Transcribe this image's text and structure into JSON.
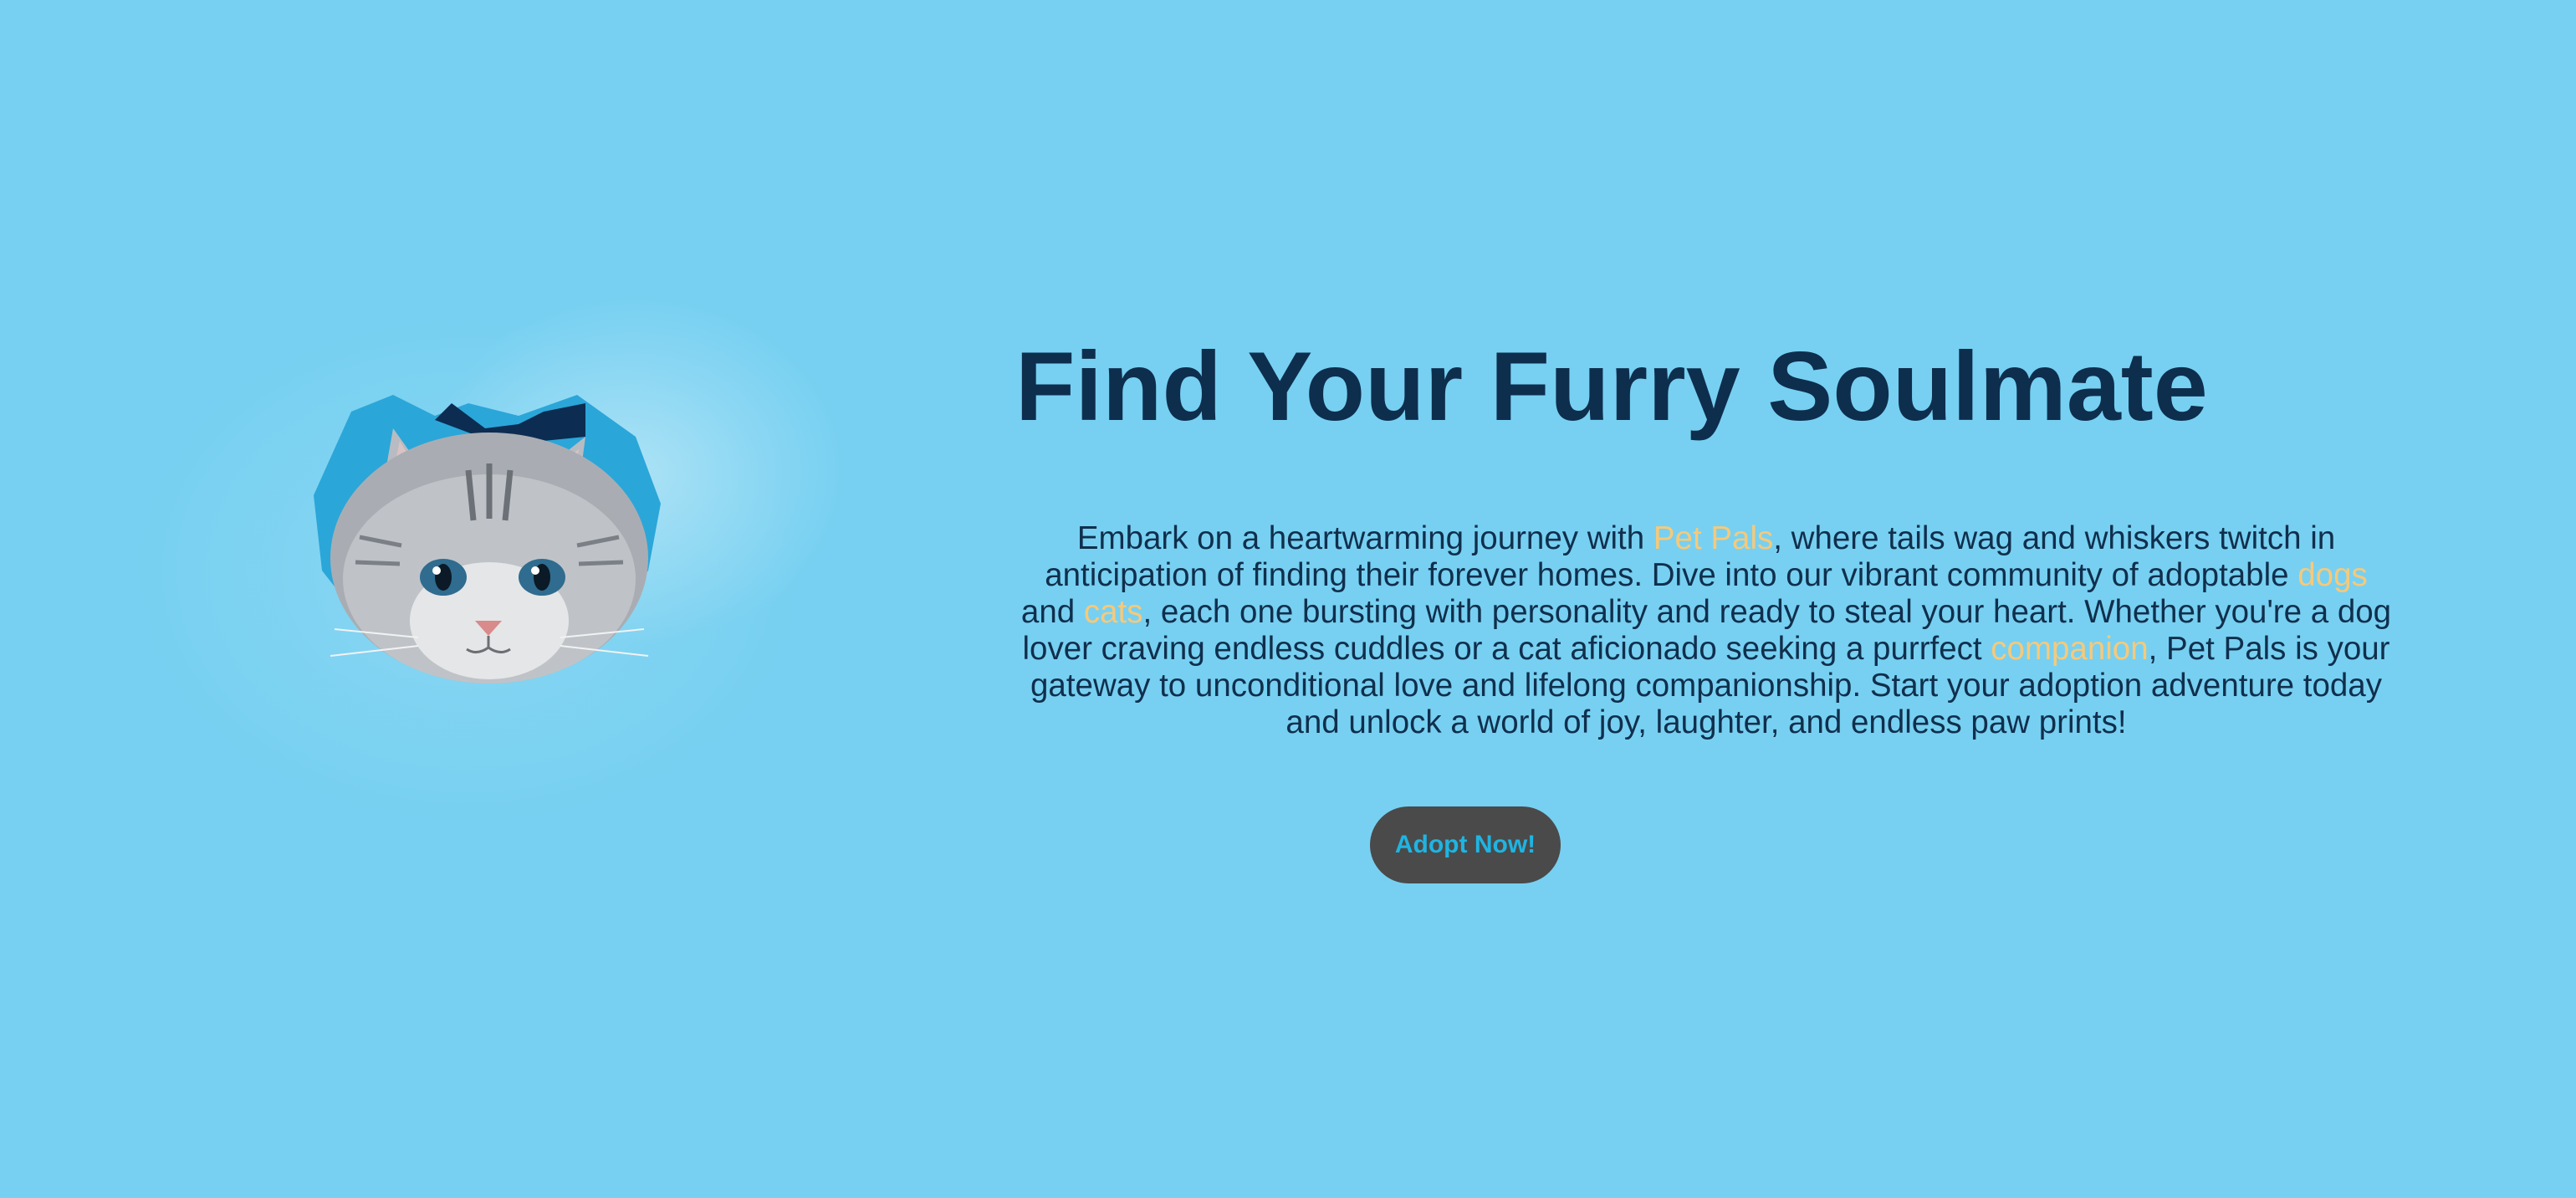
{
  "hero": {
    "image_icon": "cat-peeking-through-paper-icon",
    "title": "Find Your Furry Soulmate",
    "description": {
      "part1": "Embark on a heartwarming journey with ",
      "brand": "Pet Pals",
      "part2": ", where tails wag and whiskers twitch in anticipation of finding their forever homes. Dive into our vibrant community of adoptable ",
      "dogs": "dogs",
      "part3": " and ",
      "cats": "cats",
      "part4": ", each one bursting with personality and ready to steal your heart. Whether you're a dog lover craving endless cuddles or a cat aficionado seeking a purrfect ",
      "companion": "companion",
      "part5": ", Pet Pals is your gateway to unconditional love and lifelong companionship. Start your adoption adventure today and unlock a world of joy, laughter, and endless paw prints!"
    },
    "cta_label": "Adopt Now!"
  },
  "colors": {
    "background": "#77d0f1",
    "title": "#0e2e4e",
    "highlight": "#f6c97a",
    "button_bg": "#4a4a4a",
    "button_text": "#1fb4e2"
  }
}
